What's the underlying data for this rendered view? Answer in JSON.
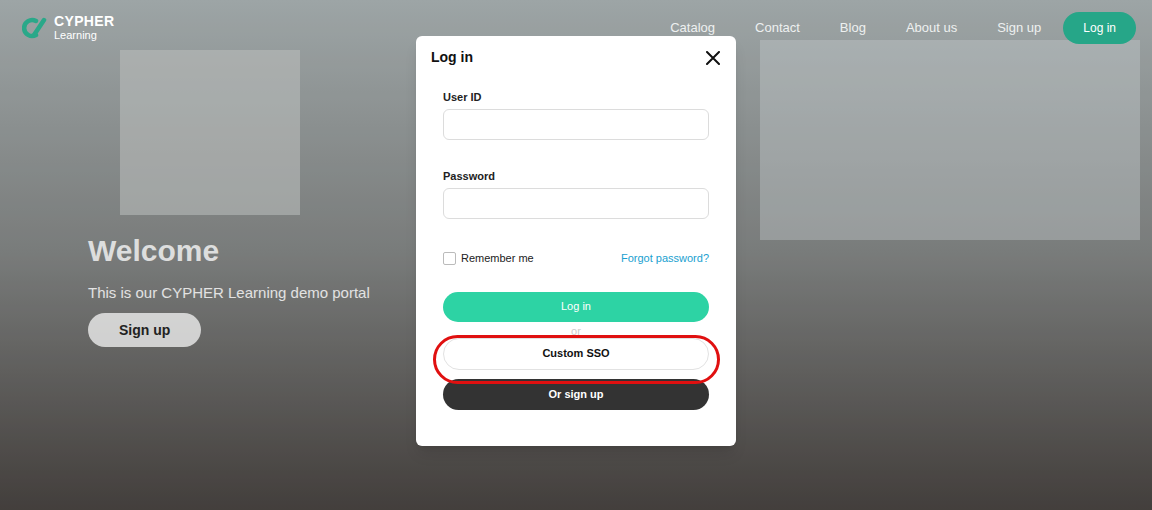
{
  "header": {
    "logo": {
      "line1": "CYPHER",
      "line2": "Learning"
    },
    "nav": [
      {
        "label": "Catalog"
      },
      {
        "label": "Contact"
      },
      {
        "label": "Blog"
      },
      {
        "label": "About us"
      },
      {
        "label": "Sign up"
      }
    ],
    "login_button": "Log in"
  },
  "hero": {
    "title": "Welcome",
    "subtitle": "This is our CYPHER Learning demo portal",
    "button": "Sign up"
  },
  "modal": {
    "title": "Log in",
    "fields": [
      {
        "label": "User ID",
        "value": ""
      },
      {
        "label": "Password",
        "value": ""
      }
    ],
    "remember": {
      "label": "Remember me",
      "checked": false
    },
    "forgot": "Forgot password?",
    "login": "Log in",
    "or": "or",
    "sso": {
      "label": "Custom SSO",
      "highlighted": true
    },
    "signup": "Or sign up"
  }
}
